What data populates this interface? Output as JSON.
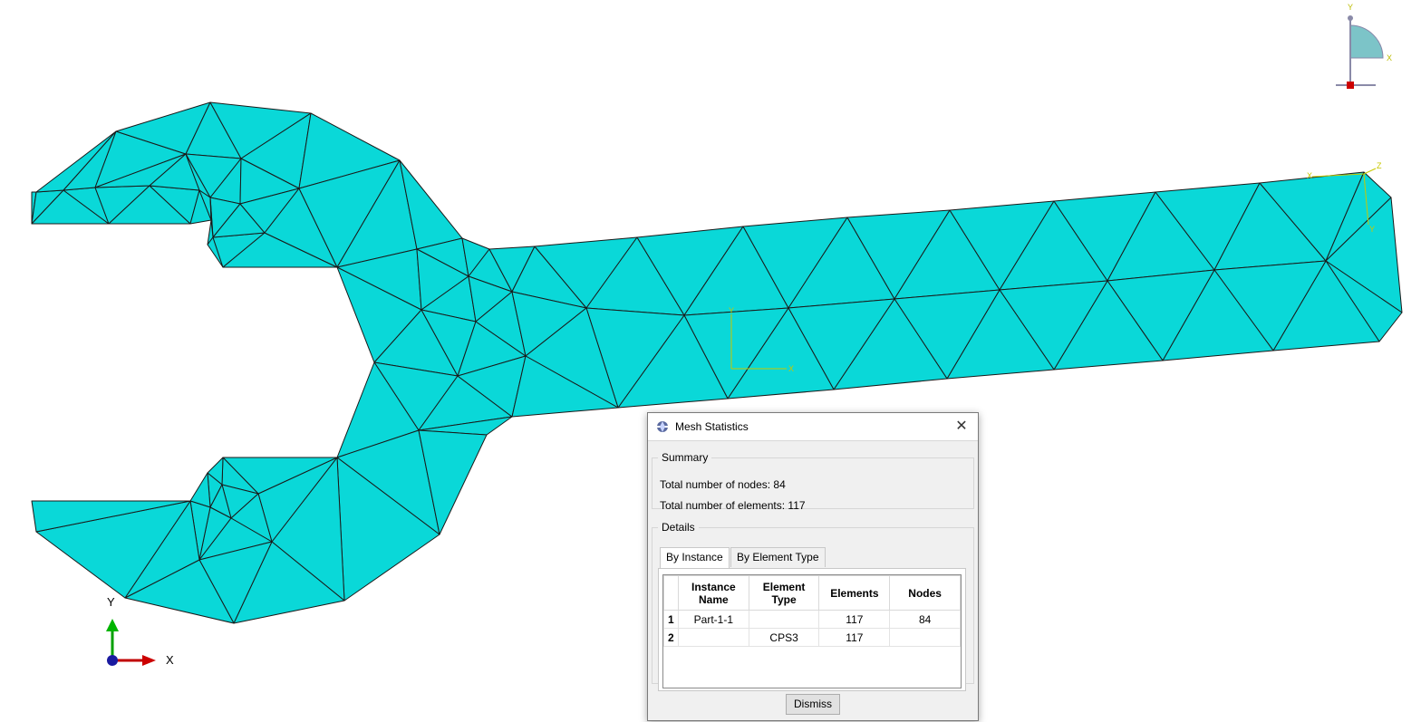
{
  "viewport": {
    "global_axis": {
      "x_label": "X",
      "y_label": "Y"
    },
    "local_csys": {
      "x_label": "X",
      "y_label": "Y"
    },
    "corner_csys": {
      "x_label": "X",
      "y_label": "Y",
      "z_label": "Z"
    },
    "view_cube": {
      "x_label": "X",
      "y_label": "Y"
    },
    "mesh_color": "#0ad8d8"
  },
  "dialog": {
    "title": "Mesh Statistics",
    "close_glyph": "✕",
    "summary": {
      "legend": "Summary",
      "nodes_line": "Total number of nodes: 84",
      "elements_line": "Total number of elements: 117"
    },
    "details": {
      "legend": "Details",
      "tabs": [
        {
          "label": "By Instance",
          "active": true
        },
        {
          "label": "By Element Type",
          "active": false
        }
      ],
      "table": {
        "headers": [
          "Instance Name",
          "Element Type",
          "Elements",
          "Nodes"
        ],
        "rows": [
          {
            "index": "1",
            "instance": "Part-1-1",
            "element_type": "",
            "elements": "117",
            "nodes": "84"
          },
          {
            "index": "2",
            "instance": "",
            "element_type": "CPS3",
            "elements": "117",
            "nodes": ""
          }
        ]
      }
    },
    "dismiss_label": "Dismiss"
  }
}
